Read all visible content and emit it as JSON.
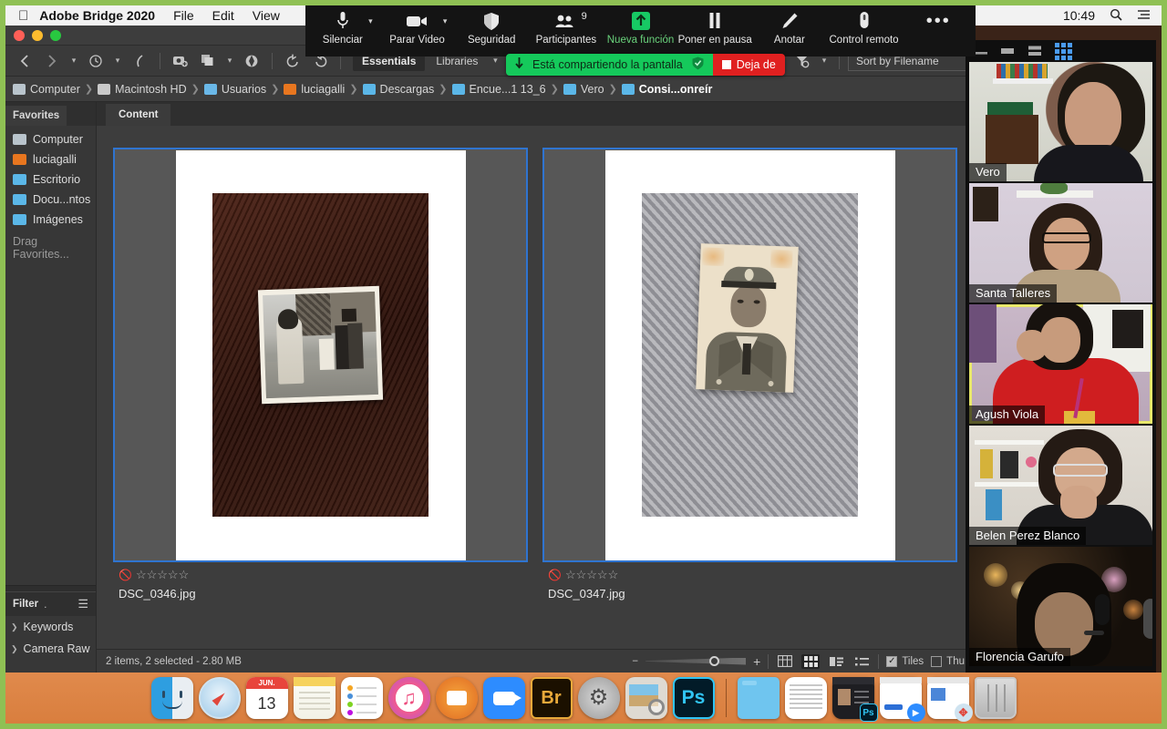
{
  "menubar": {
    "apple_icon": "apple-logo",
    "app_title": "Adobe Bridge 2020",
    "items": [
      "File",
      "Edit",
      "View"
    ],
    "clock": "10:49",
    "search_icon": "search-icon",
    "control_center_icon": "list-icon"
  },
  "zoom_toolbar": {
    "items": [
      {
        "label": "Silenciar",
        "icon": "microphone-icon",
        "caret": true,
        "highlight": false
      },
      {
        "label": "Parar Video",
        "icon": "video-camera-icon",
        "caret": true,
        "highlight": false
      },
      {
        "label": "Seguridad",
        "icon": "shield-icon",
        "caret": false,
        "highlight": false
      },
      {
        "label": "Participantes",
        "icon": "people-icon",
        "caret": false,
        "highlight": false,
        "badge": "9"
      },
      {
        "label": "Nueva función",
        "icon": "share-screen-up-arrow-icon",
        "caret": false,
        "highlight": true
      },
      {
        "label": "Poner en pausa",
        "icon": "pause-icon",
        "caret": false,
        "highlight": false
      },
      {
        "label": "Anotar",
        "icon": "pencil-icon",
        "caret": false,
        "highlight": false
      },
      {
        "label": "Control remoto",
        "icon": "remote-control-icon",
        "caret": false,
        "highlight": false
      },
      {
        "label": "",
        "icon": "more-dots-icon",
        "caret": false,
        "highlight": false
      }
    ],
    "share_banner": {
      "status_text": "Está compartiendo la pantalla",
      "stop_label": "Deja de",
      "lock_icon": "shield-check-icon",
      "arrow_icon": "down-arrow-icon",
      "green": "#15c95b",
      "red": "#e02020"
    }
  },
  "bridge": {
    "window_controls": [
      "close",
      "minimize",
      "zoom"
    ],
    "toolbar": {
      "back_icon": "chevron-left-icon",
      "forward_icon": "chevron-right-icon",
      "dropdown_icon": "chevron-down-icon",
      "recent_icon": "clock-history-icon",
      "boomerang_icon": "go-back-curve-icon",
      "camera_raw_icon": "camera-add-icon",
      "copy_icon": "copy-icon",
      "refine_icon": "aperture-icon",
      "rotate_ccw_icon": "rotate-counterclockwise-icon",
      "rotate_cw_icon": "rotate-clockwise-icon",
      "workspace_active": "Essentials",
      "workspace_next": "Libraries",
      "workspace_caret": "chevron-down-icon",
      "rating_icon": "rating-filter-icon",
      "sort_icon": "sort-ascending-icon",
      "filter_icon": "filter-funnel-icon",
      "sort_box": "Sort by Filename"
    },
    "path": [
      {
        "label": "Computer",
        "icon": "computer-icon"
      },
      {
        "label": "Macintosh HD",
        "icon": "harddisk-icon"
      },
      {
        "label": "Usuarios",
        "icon": "users-folder-icon"
      },
      {
        "label": "luciagalli",
        "icon": "home-folder-icon"
      },
      {
        "label": "Descargas",
        "icon": "downloads-folder-icon"
      },
      {
        "label": "Encue...1 13_6",
        "icon": "folder-icon"
      },
      {
        "label": "Vero",
        "icon": "folder-icon"
      },
      {
        "label": "Consi...onreír",
        "icon": "folder-icon"
      }
    ],
    "favorites_panel": {
      "tab": "Favorites",
      "items": [
        {
          "label": "Computer",
          "icon": "computer-icon"
        },
        {
          "label": "luciagalli",
          "icon": "home-folder-icon"
        },
        {
          "label": "Escritorio",
          "icon": "folder-icon"
        },
        {
          "label": "Docu...ntos",
          "icon": "folder-icon"
        },
        {
          "label": "Imágenes",
          "icon": "pictures-folder-icon"
        }
      ],
      "drag_hint": "Drag Favorites..."
    },
    "filter_panel": {
      "title": "Filter",
      "dot": ".",
      "menu_icon": "hamburger-menu-icon",
      "rows": [
        {
          "label": "Keywords",
          "arrow": "chevron-right-icon"
        },
        {
          "label": "Camera Raw",
          "arrow": "chevron-right-icon"
        }
      ]
    },
    "content": {
      "tab": "Content",
      "selection_color": "#2f74d0",
      "items": [
        {
          "filename": "DSC_0346.jpg",
          "rating_icon": "no-rating-icon",
          "stars": "☆☆☆☆☆",
          "selected": true,
          "alt": "old black and white snapshot of people outside a house, lying on a dark wooden table"
        },
        {
          "filename": "DSC_0347.jpg",
          "rating_icon": "no-rating-icon",
          "stars": "☆☆☆☆☆",
          "selected": true,
          "alt": "sepia portrait photo of a young man in military uniform and peaked cap, on a grey knit blanket"
        }
      ]
    },
    "statusbar": {
      "items_text": "2 items, 2 selected - 2.80 MB",
      "zoom_out_icon": "minus-icon",
      "zoom_in_icon": "plus-icon",
      "view_modes": [
        {
          "icon": "grid-locked-icon",
          "active": false
        },
        {
          "icon": "thumbnail-grid-icon",
          "active": true
        },
        {
          "icon": "details-view-icon",
          "active": false
        },
        {
          "icon": "list-view-icon",
          "active": false
        }
      ],
      "checkboxes": [
        {
          "label": "Tiles",
          "checked": true
        },
        {
          "label": "Thu",
          "checked": false
        }
      ]
    }
  },
  "zoom_panel": {
    "header_icons": [
      {
        "icon": "minimize-view-icon",
        "active": false
      },
      {
        "icon": "single-speaker-view-icon",
        "active": false
      },
      {
        "icon": "split-view-icon",
        "active": false
      },
      {
        "icon": "gallery-view-icon",
        "active": true
      }
    ],
    "participants": [
      {
        "name": "Vero",
        "active_speaker": false
      },
      {
        "name": "Santa Talleres",
        "active_speaker": false
      },
      {
        "name": "Agush Viola",
        "active_speaker": true
      },
      {
        "name": "Belen Perez Blanco",
        "active_speaker": false
      },
      {
        "name": "Florencia Garufo",
        "active_speaker": false
      }
    ],
    "active_speaker_color": "#e8e86a"
  },
  "dock": {
    "apps": [
      {
        "name": "Finder",
        "icon": "finder-icon"
      },
      {
        "name": "Safari",
        "icon": "safari-compass-icon"
      },
      {
        "name": "Calendar",
        "icon": "calendar-icon",
        "month": "JUN.",
        "day": "13"
      },
      {
        "name": "Notes",
        "icon": "notes-icon"
      },
      {
        "name": "Reminders",
        "icon": "reminders-icon"
      },
      {
        "name": "iTunes",
        "icon": "itunes-music-note-icon"
      },
      {
        "name": "Books",
        "icon": "books-icon"
      },
      {
        "name": "Zoom",
        "icon": "zoom-video-icon"
      },
      {
        "name": "Adobe Bridge",
        "icon": "bridge-br-icon",
        "label": "Br"
      },
      {
        "name": "System Preferences",
        "icon": "system-preferences-gear-icon"
      },
      {
        "name": "Preview",
        "icon": "preview-icon"
      },
      {
        "name": "Adobe Photoshop",
        "icon": "photoshop-ps-icon",
        "label": "Ps"
      }
    ],
    "windows": [
      {
        "name": "Folder",
        "icon": "folder-icon"
      },
      {
        "name": "Document window",
        "icon": "document-window-icon"
      },
      {
        "name": "Photoshop window",
        "icon": "photoshop-window-icon",
        "badge": "Ps"
      },
      {
        "name": "Zoom window",
        "icon": "zoom-window-icon",
        "badge": "zoom"
      },
      {
        "name": "Safari window",
        "icon": "safari-window-icon",
        "badge": "safari"
      },
      {
        "name": "Trash",
        "icon": "trash-full-icon"
      }
    ]
  },
  "screen_share_border_color": "#8fc054"
}
